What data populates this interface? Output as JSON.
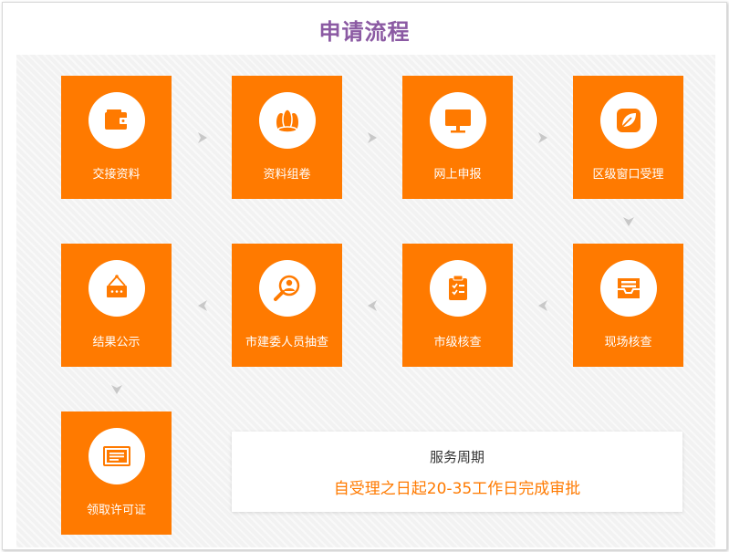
{
  "title": "申请流程",
  "steps": [
    {
      "label": "交接资料",
      "icon": "wallet-icon"
    },
    {
      "label": "资料组卷",
      "icon": "scroll-bundle-icon"
    },
    {
      "label": "网上申报",
      "icon": "monitor-icon"
    },
    {
      "label": "区级窗口受理",
      "icon": "leaf-edit-icon"
    },
    {
      "label": "现场核查",
      "icon": "inbox-tray-icon"
    },
    {
      "label": "市级核查",
      "icon": "clipboard-check-icon"
    },
    {
      "label": "市建委人员抽查",
      "icon": "magnifier-person-icon"
    },
    {
      "label": "结果公示",
      "icon": "hanging-sign-icon"
    },
    {
      "label": "领取许可证",
      "icon": "certificate-icon"
    }
  ],
  "service_period": {
    "heading": "服务周期",
    "detail": "自受理之日起20-35工作日完成审批"
  },
  "colors": {
    "step_bg": "#ff7a00",
    "title": "#8b5aa3",
    "arrow": "#c8c8c8",
    "highlight_text": "#ff7a00"
  }
}
